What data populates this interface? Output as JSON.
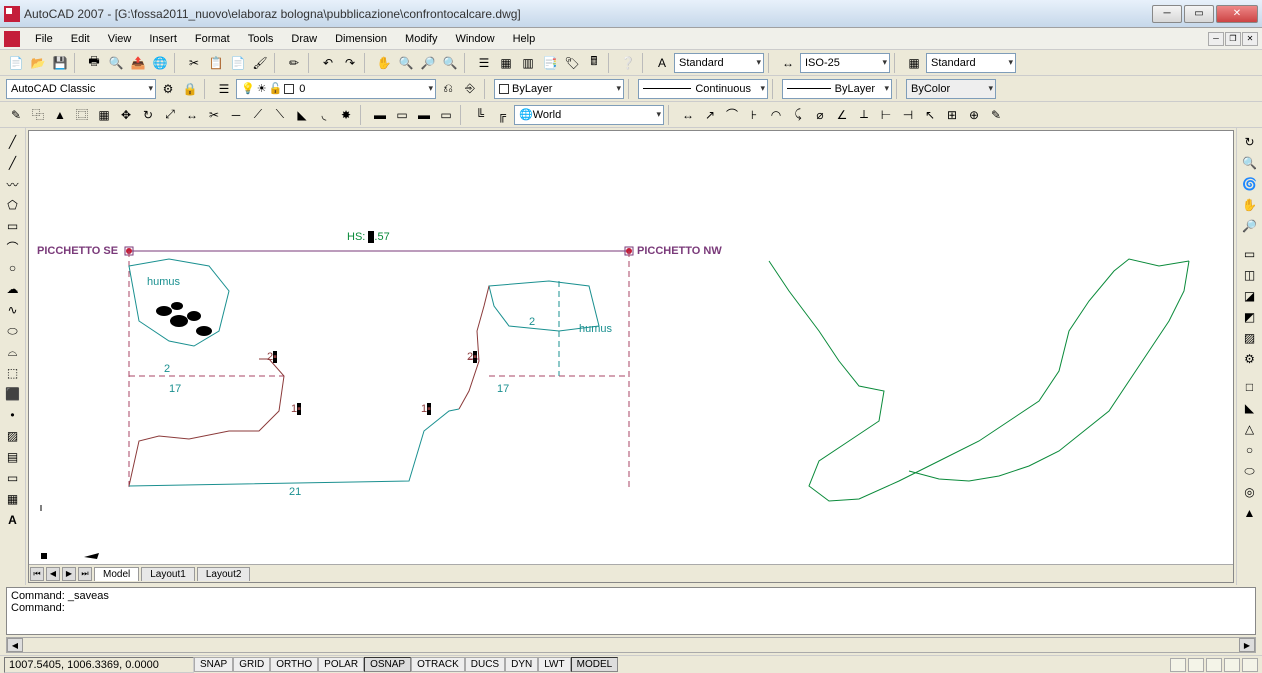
{
  "title": "AutoCAD 2007 - [G:\\fossa2011_nuovo\\elaboraz bologna\\pubblicazione\\confrontocalcare.dwg]",
  "menu": [
    "File",
    "Edit",
    "View",
    "Insert",
    "Format",
    "Tools",
    "Draw",
    "Dimension",
    "Modify",
    "Window",
    "Help"
  ],
  "workspace": "AutoCAD Classic",
  "layer": "0",
  "style_combo": "Standard",
  "dimstyle": "ISO-25",
  "tablestyle": "Standard",
  "bylayer1": "ByLayer",
  "linetype": "Continuous",
  "lineweight": "ByLayer",
  "bycolor": "ByColor",
  "ucs": "World",
  "tabs": {
    "model": "Model",
    "l1": "Layout1",
    "l2": "Layout2"
  },
  "cmd": {
    "line1": "Command: _saveas",
    "line2": "Command:"
  },
  "status": {
    "coords": "1007.5405, 1006.3369, 0.0000",
    "toggles": [
      "SNAP",
      "GRID",
      "ORTHO",
      "POLAR",
      "OSNAP",
      "OTRACK",
      "DUCS",
      "DYN",
      "LWT",
      "MODEL"
    ]
  },
  "drawing": {
    "hs_label": "HS: ",
    "hs_rest": ".57",
    "p_se": "PICCHETTO SE",
    "p_nw": "PICCHETTO NW",
    "humus1": "humus",
    "humus2": "humus",
    "n2a": "2",
    "n2b": "2",
    "n17a": "17",
    "n17b": "17",
    "n21": "21",
    "n20a": "20",
    "n1a": "1a",
    "n20b": "20",
    "n1b": "1a"
  }
}
